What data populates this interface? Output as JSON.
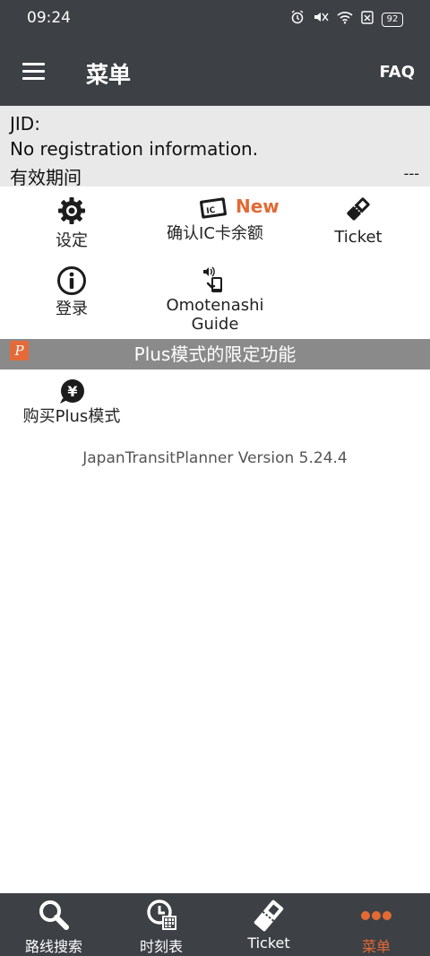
{
  "status_bar": {
    "time": "09:24",
    "battery": "92",
    "icons": [
      "alarm-icon",
      "mute-icon",
      "wifi-icon",
      "sim-off-icon",
      "battery-icon"
    ]
  },
  "app_bar": {
    "title": "菜单",
    "faq_label": "FAQ"
  },
  "account": {
    "jid_label": "JID:",
    "registration_text": "No registration information.",
    "validity_label": "有效期间",
    "validity_value": "---"
  },
  "menu": {
    "settings_label": "设定",
    "ic_card_label": "确认IC卡余额",
    "ic_card_badge": "New",
    "ticket_label": "Ticket",
    "login_label": "登录",
    "omotenashi_line1": "Omotenashi",
    "omotenashi_line2": "Guide"
  },
  "plus": {
    "banner_title": "Plus模式的限定功能",
    "buy_label": "购买Plus模式"
  },
  "version_text": "JapanTransitPlanner Version 5.24.4",
  "bottom_nav": {
    "route_search": "路线搜索",
    "timetable": "时刻表",
    "ticket": "Ticket",
    "menu": "菜单"
  },
  "colors": {
    "bar_dark": "#3d4045",
    "accent_orange": "#e26a35",
    "section_gray": "#8a8a8a",
    "account_bg": "#e9e9e9"
  }
}
